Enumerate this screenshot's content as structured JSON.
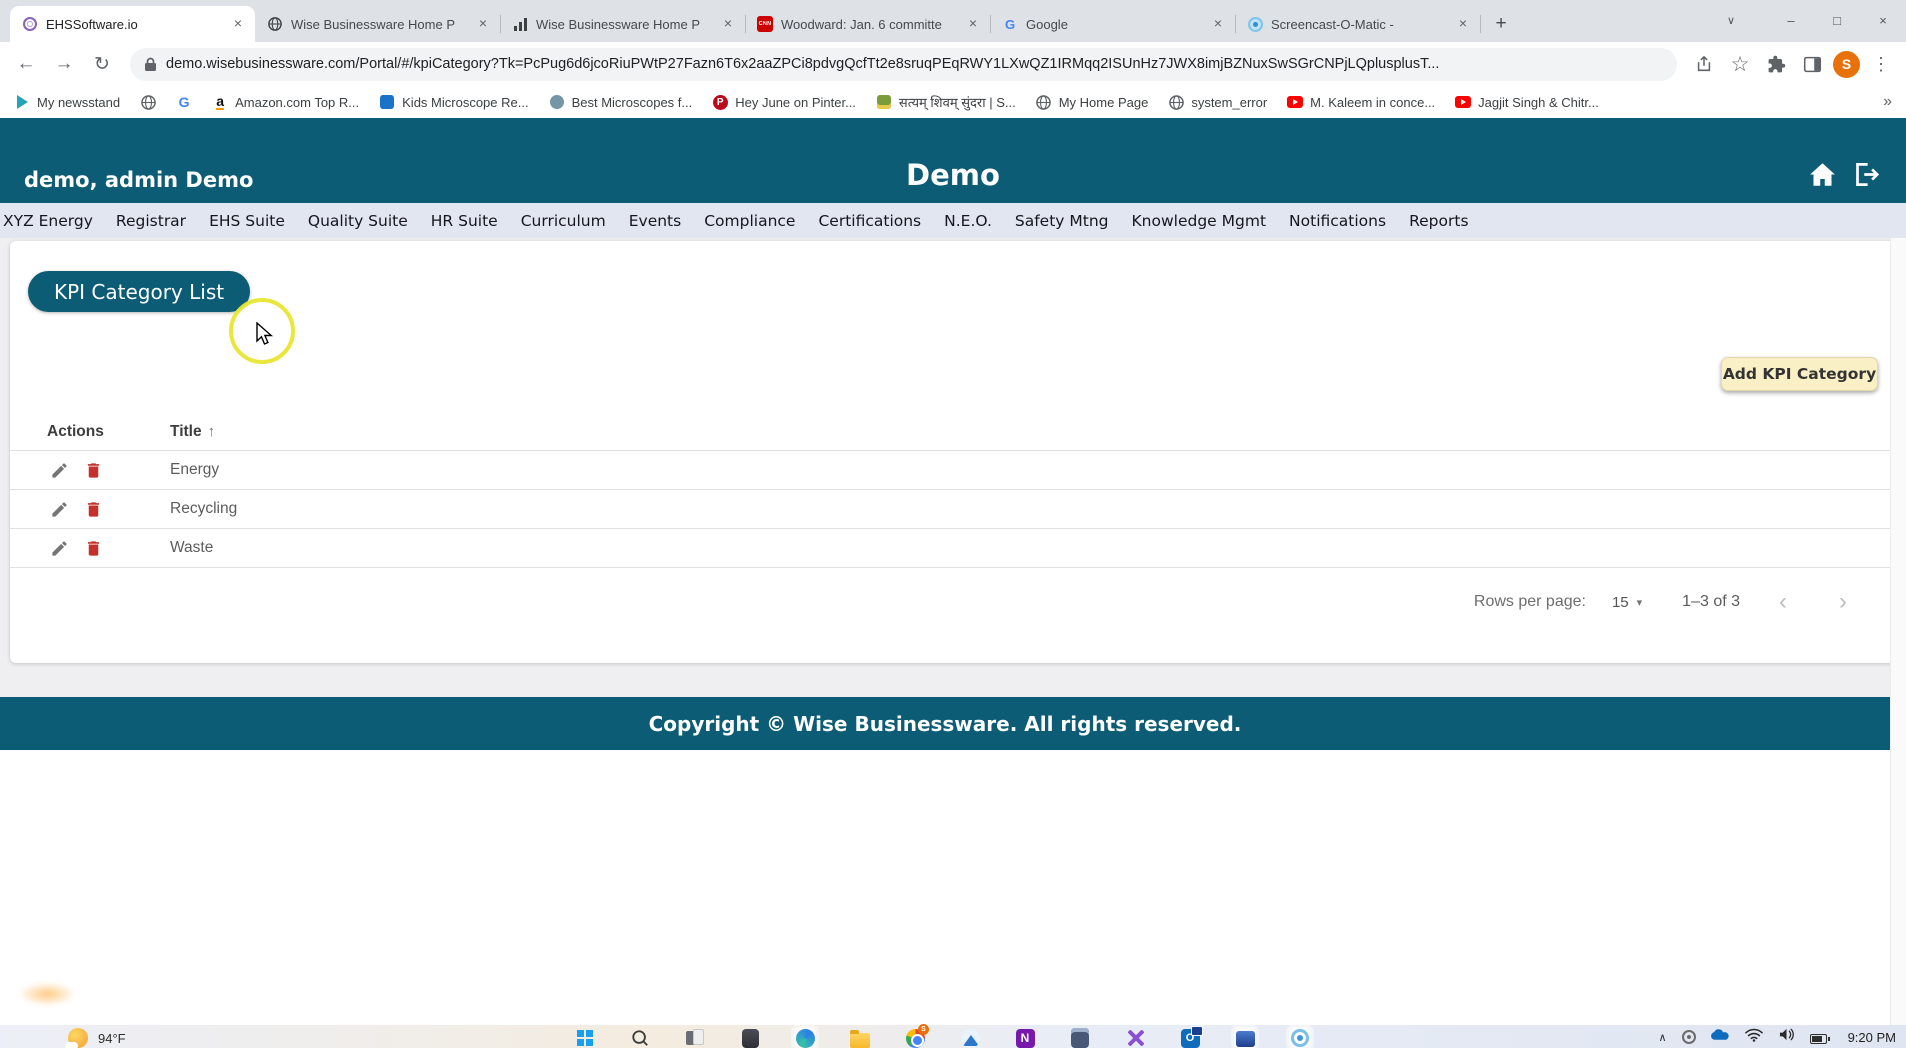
{
  "colors": {
    "teal": "#0b5c74",
    "nav_bg": "#e2e6f1",
    "button_cream": "#faf0c5",
    "trash_red": "#c4302b",
    "pencil_gray": "#757575",
    "highlight_yellow": "#e8e630"
  },
  "browser": {
    "glyphs": {
      "back": "←",
      "forward": "→",
      "reload": "↻",
      "star": "☆",
      "menu": "⋮",
      "new_tab": "+",
      "tab_search": "∨",
      "minimize": "–",
      "maximize": "□",
      "close_window": "×",
      "close_tab": "×",
      "bookmarks_overflow": "»"
    },
    "tabs": [
      {
        "title": "EHSSoftware.io",
        "icon": "knot-icon",
        "active": true
      },
      {
        "title": "Wise Businessware Home P",
        "icon": "globe-icon",
        "active": false
      },
      {
        "title": "Wise Businessware Home P",
        "icon": "bar-chart-icon",
        "active": false
      },
      {
        "title": "Woodward: Jan. 6 committe",
        "icon": "cnn-icon",
        "active": false
      },
      {
        "title": "Google",
        "icon": "google-icon",
        "active": false
      },
      {
        "title": "Screencast-O-Matic -",
        "icon": "screencast-icon",
        "active": false
      }
    ],
    "url": "demo.wisebusinessware.com/Portal/#/kpiCategory?Tk=PcPug6d6jcoRiuPWtP27Fazn6T6x2aaZPCi8pdvgQcfTt2e8sruqPEqRWY1LXwQZ1IRMqq2ISUnHz7JWX8imjBZNuxSwSGrCNPjLQplusplusT...",
    "avatar": "S",
    "bookmarks": [
      {
        "label": "My newsstand",
        "icon": "newsstand-play-icon"
      },
      {
        "label": "",
        "icon": "globe-icon"
      },
      {
        "label": "",
        "icon": "google-icon"
      },
      {
        "label": "Amazon.com Top R...",
        "icon": "amazon-icon"
      },
      {
        "label": "Kids Microscope Re...",
        "icon": "blue-site-icon"
      },
      {
        "label": "Best Microscopes f...",
        "icon": "slate-site-icon"
      },
      {
        "label": "Hey June on Pinter...",
        "icon": "pinterest-icon"
      },
      {
        "label": "सत्यम् शिवम् सुंदरा | S...",
        "icon": "green-site-icon"
      },
      {
        "label": "My Home Page",
        "icon": "globe-icon"
      },
      {
        "label": "system_error",
        "icon": "globe-icon"
      },
      {
        "label": "M. Kaleem in conce...",
        "icon": "youtube-icon"
      },
      {
        "label": "Jagjit Singh & Chitr...",
        "icon": "youtube-icon"
      }
    ]
  },
  "app": {
    "header": {
      "user": "demo, admin Demo",
      "title": "Demo"
    },
    "nav": [
      "XYZ Energy",
      "Registrar",
      "EHS Suite",
      "Quality Suite",
      "HR Suite",
      "Curriculum",
      "Events",
      "Compliance",
      "Certifications",
      "N.E.O.",
      "Safety Mtng",
      "Knowledge Mgmt",
      "Notifications",
      "Reports"
    ],
    "page": {
      "title_chip": "KPI Category List",
      "add_button": "Add KPI Category",
      "table": {
        "actions_header": "Actions",
        "title_header": "Title",
        "sort_glyph": "↑",
        "rows": [
          {
            "title": "Energy"
          },
          {
            "title": "Recycling"
          },
          {
            "title": "Waste"
          }
        ]
      },
      "pagination": {
        "label": "Rows per page:",
        "value": "15",
        "caret": "▾",
        "range": "1–3 of 3",
        "prev": "‹",
        "next": "›"
      }
    },
    "footer": "Copyright © Wise Businessware. All rights reserved."
  },
  "taskbar": {
    "weather": "94°F",
    "time": "9:20 PM",
    "tray_chevron": "∧"
  }
}
